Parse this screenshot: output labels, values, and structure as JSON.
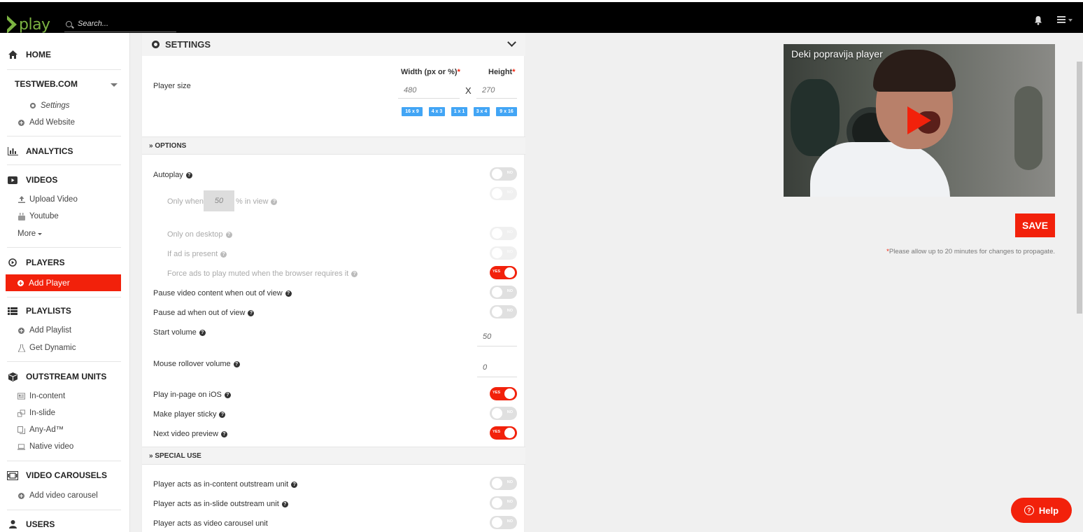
{
  "topbar": {
    "logo_text": "play",
    "search_placeholder": "Search...",
    "icons": [
      "bell-icon",
      "menu-icon"
    ]
  },
  "sidebar": {
    "home": "HOME",
    "site": "TESTWEB.COM",
    "site_items": [
      "Settings",
      "Add Website"
    ],
    "analytics": "ANALYTICS",
    "videos": "VIDEOS",
    "video_items": [
      "Upload Video",
      "Youtube",
      "More"
    ],
    "players": "PLAYERS",
    "add_player": "Add Player",
    "playlists": "PLAYLISTS",
    "playlist_items": [
      "Add Playlist",
      "Get Dynamic"
    ],
    "outstream": "OUTSTREAM UNITS",
    "outstream_items": [
      "In-content",
      "In-slide",
      "Any-Ad™",
      "Native video"
    ],
    "carousels": "VIDEO CAROUSELS",
    "carousel_items": [
      "Add video carousel"
    ],
    "users": "USERS"
  },
  "settings": {
    "title": "SETTINGS",
    "player_size_label": "Player size",
    "width_label": "Width (px or %)",
    "height_label": "Height",
    "required_mark": "*",
    "width_placeholder": "480",
    "height_placeholder": "270",
    "x_sep": "X",
    "ratios": [
      "16 x 9",
      "4 x 3",
      "1 x 1",
      "3 x 4",
      "9 x 16"
    ],
    "options_title": "» OPTIONS",
    "autoplay": "Autoplay",
    "only_when": "Only when",
    "inview_value": "50",
    "in_view": "% in view",
    "only_desktop": "Only on desktop",
    "if_ad": "If ad is present",
    "force_muted": "Force ads to play muted when the browser requires it",
    "pause_content": "Pause video content when out of view",
    "pause_ad": "Pause ad when out of view",
    "start_volume": "Start volume",
    "start_volume_value": "50",
    "rollover_volume": "Mouse rollover volume",
    "rollover_volume_value": "0",
    "play_inpage": "Play in-page on iOS",
    "sticky": "Make player sticky",
    "next_preview": "Next video preview",
    "special_title": "» SPECIAL USE",
    "in_content_unit": "Player acts as in-content outstream unit",
    "in_slide_unit": "Player acts as in-slide outstream unit",
    "carousel_unit": "Player acts as video carousel unit",
    "toggle_no": "NO",
    "toggle_yes": "YES",
    "help_glyph": "?"
  },
  "preview": {
    "title": "Deki popravija player"
  },
  "save_label": "SAVE",
  "note_mark": "*",
  "note": "Please allow up to 20 minutes for changes to propagate.",
  "help_label": "Help",
  "help_icon_glyph": "?",
  "colors": {
    "accent": "#f2210b",
    "logo": "#7cb342",
    "ratio": "#42a5f5"
  }
}
